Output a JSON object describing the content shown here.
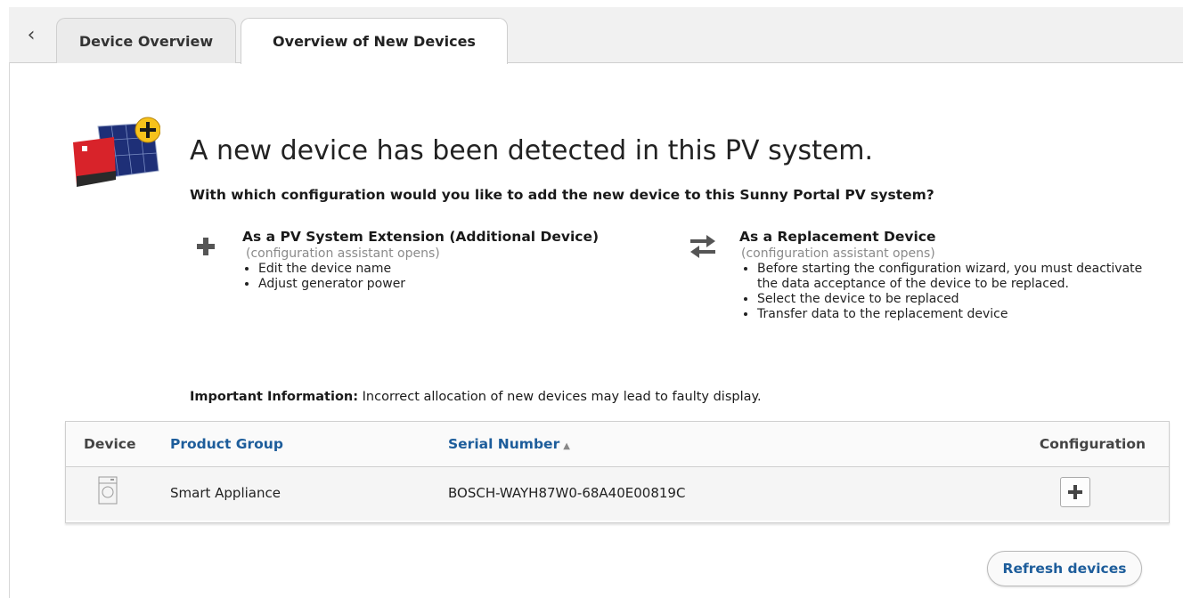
{
  "tabs": {
    "back_icon": "chevron-left-icon",
    "items": [
      {
        "label": "Device Overview",
        "active": false
      },
      {
        "label": "Overview of New Devices",
        "active": true
      }
    ]
  },
  "hero": {
    "icon": "inverter-solar-add-icon",
    "headline": "A new device has been detected in this PV system.",
    "question": "With which configuration would you like to add the new device to this Sunny Portal PV system?"
  },
  "options": [
    {
      "icon": "plus-icon",
      "title": "As a PV System Extension (Additional Device)",
      "subtitle": "(configuration assistant opens)",
      "bullets": [
        "Edit the device name",
        "Adjust generator power"
      ]
    },
    {
      "icon": "swap-arrows-icon",
      "title": "As a Replacement Device",
      "subtitle": "(configuration assistant opens)",
      "bullets": [
        "Before starting the configuration wizard, you must deactivate the data acceptance of the device to be replaced.",
        "Select the device to be replaced",
        "Transfer data to the replacement device"
      ]
    }
  ],
  "important": {
    "label": "Important Information:",
    "text": " Incorrect allocation of new devices may lead to faulty display."
  },
  "table": {
    "headers": {
      "device": "Device",
      "product_group": "Product Group",
      "serial_number": "Serial Number",
      "configuration": "Configuration"
    },
    "sort_indicator": "▲",
    "rows": [
      {
        "device_icon": "appliance-icon",
        "product_group": "Smart Appliance",
        "serial_number": "BOSCH-WAYH87W0-68A40E00819C",
        "action_icon": "plus-icon"
      }
    ]
  },
  "refresh_label": "Refresh devices",
  "colors": {
    "link": "#1d5d9b",
    "accent_yellow": "#f7c21b",
    "inverter_red": "#d8232a"
  }
}
